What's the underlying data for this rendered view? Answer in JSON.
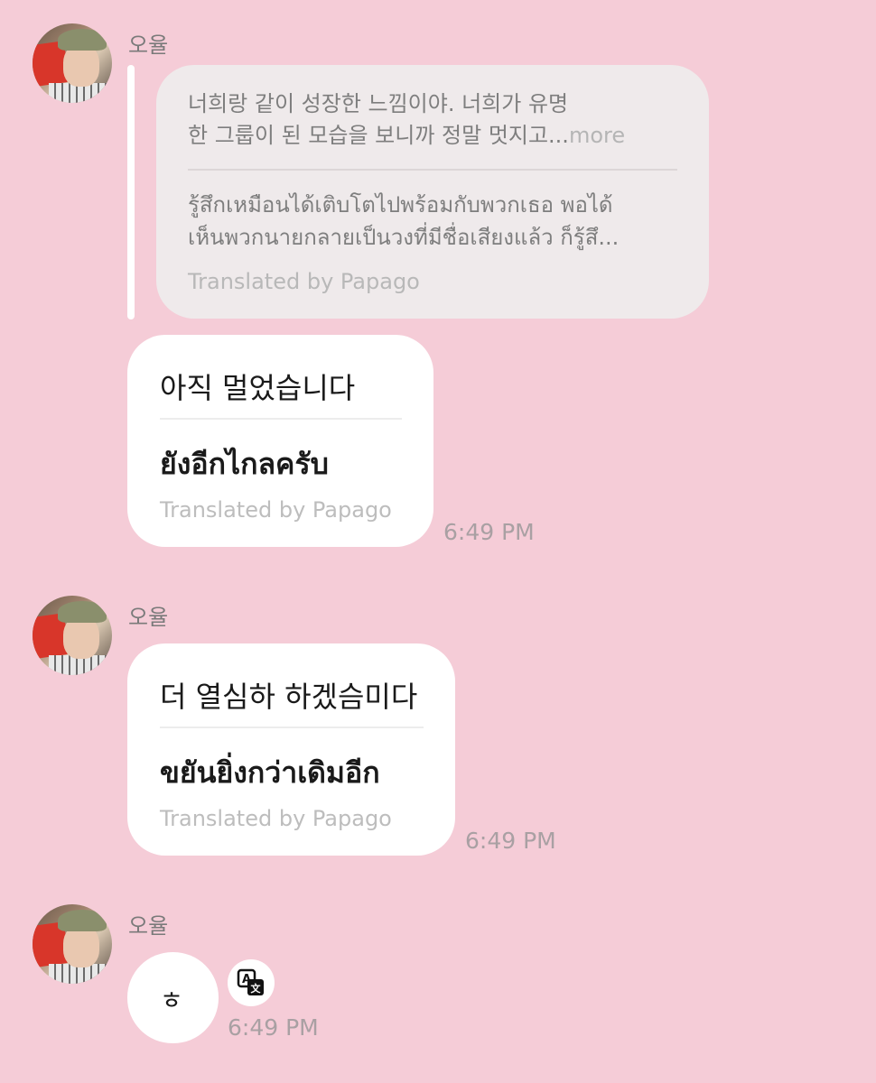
{
  "messages": [
    {
      "sender": "오율",
      "quoted": {
        "korean_line1": "너희랑 같이 성장한 느낌이야. 너희가 유명",
        "korean_line2": "한 그룹이 된 모습을 보니까 정말 멋지고...",
        "more": "more",
        "thai_line1": "รู้สึกเหมือนได้เติบโตไปพร้อมกับพวกเธอ พอได้",
        "thai_line2": "เห็นพวกนายกลายเป็นวงที่มีชื่อเสียงแล้ว ก็รู้สึ...",
        "translated_by": "Translated by Papago"
      },
      "text": "아직 멀었습니다",
      "translation": "ยังอีกไกลครับ",
      "translated_by": "Translated by Papago",
      "time": "6:49 PM"
    },
    {
      "sender": "오율",
      "text": "더 열심하 하겠슴미다",
      "translation": "ขยันยิ่งกว่าเดิมอีก",
      "translated_by": "Translated by Papago",
      "time": "6:49 PM"
    },
    {
      "sender": "오율",
      "text": "ㅎ",
      "translate_icon": "translate-icon",
      "time": "6:49 PM"
    }
  ],
  "colors": {
    "background": "#f5ccd7",
    "bubble": "#ffffff",
    "quote_bubble": "#efeaeb"
  }
}
